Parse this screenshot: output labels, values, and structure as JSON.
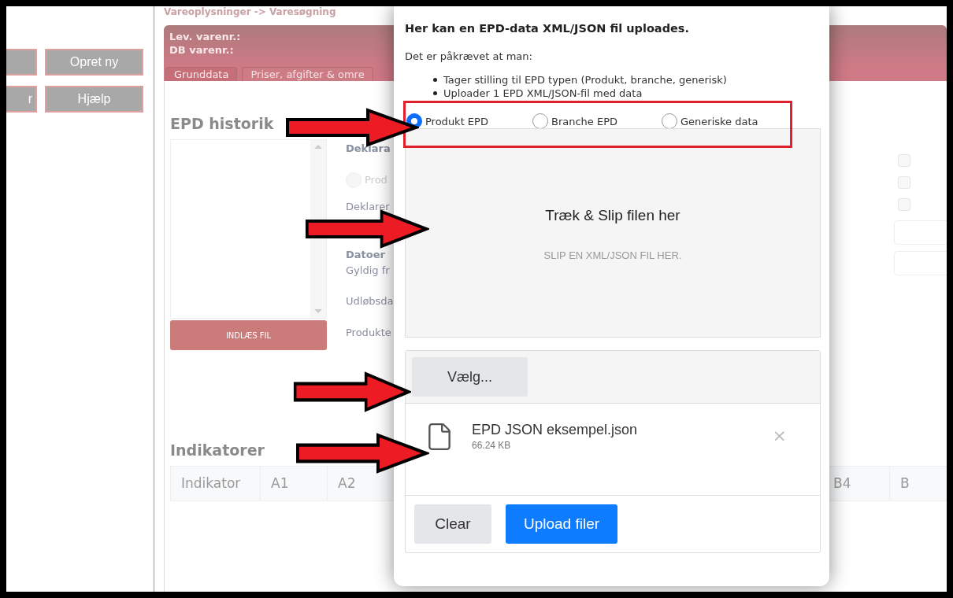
{
  "sidebar": {
    "buttons": [
      {
        "kind": "cut"
      },
      {
        "kind": "full",
        "label": "Opret ny"
      },
      {
        "kind": "cut",
        "label": "r"
      },
      {
        "kind": "full",
        "label": "Hjælp"
      }
    ]
  },
  "breadcrumb": "Vareoplysninger -> Varesøgning",
  "header": {
    "lines": [
      "Lev. varenr.:",
      "DB varenr.:"
    ]
  },
  "tabs": [
    {
      "label": "Grunddata",
      "selected": true
    },
    {
      "label": "Priser, afgifter & omre",
      "selected": false
    }
  ],
  "epd_history": {
    "title": "EPD historik",
    "load_button": "INDLÆS FIL"
  },
  "details": {
    "items": [
      {
        "kind": "heading",
        "text": "Deklara"
      },
      {
        "kind": "radio",
        "text": "Prod",
        "selected": false,
        "disabled": true
      },
      {
        "kind": "label",
        "text": "Deklarer"
      },
      {
        "kind": "heading",
        "text": "Datoer"
      },
      {
        "kind": "label",
        "text": "Gyldig fr"
      },
      {
        "kind": "label",
        "text": "Udløbsda"
      },
      {
        "kind": "label",
        "text": "Produkte"
      }
    ]
  },
  "checkboxes": [
    {
      "checked": false
    },
    {
      "checked": false
    },
    {
      "checked": false
    }
  ],
  "indicators": {
    "title": "Indikatorer",
    "columns_left": [
      "Indikator",
      "A1",
      "A2"
    ],
    "columns_right": [
      "B4",
      "B"
    ]
  },
  "modal": {
    "title": "Her kan en EPD-data XML/JSON fil uploades.",
    "intro": "Det er påkrævet at man:",
    "bullets": [
      "Tager stilling til EPD typen (Produkt, branche, generisk)",
      "Uploader 1 EPD XML/JSON-fil med data"
    ],
    "radios": [
      {
        "label": "Produkt EPD",
        "selected": true
      },
      {
        "label": "Branche EPD",
        "selected": false
      },
      {
        "label": "Generiske data",
        "selected": false
      }
    ],
    "dropzone": {
      "title": "Træk & Slip filen her",
      "hint": "SLIP EN XML/JSON FIL HER."
    },
    "choose_button": "Vælg...",
    "files": [
      {
        "name": "EPD JSON eksempel.json",
        "size": "66.24 KB",
        "remove": "×"
      }
    ],
    "buttons": [
      {
        "kind": "secondary",
        "label": "Clear"
      },
      {
        "kind": "primary",
        "label": "Upload filer"
      }
    ]
  }
}
